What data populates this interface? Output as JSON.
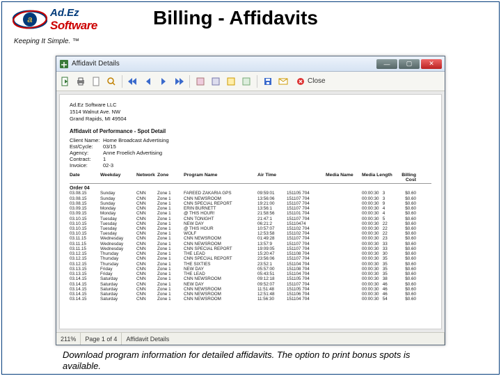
{
  "brand": {
    "line1": "Ad.Ez",
    "line2": "Software",
    "tagline": "Keeping It Simple. ™"
  },
  "slide": {
    "title": "Billing - Affidavits",
    "caption": "Download program information for detailed affidavits. The option to print bonus spots is available."
  },
  "window": {
    "title": "Affidavit Details",
    "close_label": "Close",
    "status_zoom": "211%",
    "status_page": "Page 1 of 4",
    "status_tab": "Affidavit Details"
  },
  "doc": {
    "company": "Ad.Ez Software LLC",
    "addr1": "1514 Walnut Ave. NW",
    "addr2": "Grand Rapids, MI 49504",
    "section": "Affidavit of Performance - Spot Detail",
    "meta": {
      "client_l": "Client Name:",
      "client_v": "Home Broadcast Advertising",
      "bill_l": "Est/Cycle:",
      "bill_v": "03/15",
      "agency_l": "Agency:",
      "agency_v": "Anne Froelich Advertising",
      "contract_l": "Contract:",
      "contract_v": "1",
      "invoice_l": "Invoice:",
      "invoice_v": "02-3"
    },
    "cols": {
      "date": "Date",
      "weekday": "Weekday",
      "network": "Network",
      "zone": "Zone",
      "program": "Program Name",
      "airtime": "Air Time",
      "air": " ",
      "media": "Media Name",
      "len": "Media Length",
      "bill": "Billing Cost"
    },
    "order_label": "Order 04",
    "rows": [
      {
        "date": "03.08.15",
        "wd": "Sunday",
        "net": "CNN",
        "zone": "Zone 1",
        "prog": "FAREED ZAKARIA GPS",
        "time": "09:59:01",
        "air": "151105 704",
        "media": "",
        "len": "00:00:30",
        "line": "3",
        "bill": "$0.60"
      },
      {
        "date": "03.08.15",
        "wd": "Sunday",
        "net": "CNN",
        "zone": "Zone 1",
        "prog": "CNN NEWSROOM",
        "time": "13:56:06",
        "air": "151107 704",
        "media": "",
        "len": "00:00:30",
        "line": "3",
        "bill": "$0.60"
      },
      {
        "date": "03.08.15",
        "wd": "Sunday",
        "net": "CNN",
        "zone": "Zone 1",
        "prog": "CNN SPECIAL REPORT",
        "time": "19:21:00",
        "air": "151107 704",
        "media": "",
        "len": "00:00:30",
        "line": "9",
        "bill": "$0.60"
      },
      {
        "date": "03.09.15",
        "wd": "Monday",
        "net": "CNN",
        "zone": "Zone 1",
        "prog": "ERIN BURNETT",
        "time": "13:56:1",
        "air": "151107 704",
        "media": "",
        "len": "00:00:30",
        "line": "4",
        "bill": "$0.60"
      },
      {
        "date": "03.09.15",
        "wd": "Monday",
        "net": "CNN",
        "zone": "Zone 1",
        "prog": "@ THIS HOUR!",
        "time": "21:58:56",
        "air": "151101 704",
        "media": "",
        "len": "00:00:30",
        "line": "4",
        "bill": "$0.60"
      },
      {
        "date": "03.10.15",
        "wd": "Tuesday",
        "net": "CNN",
        "zone": "Zone 1",
        "prog": "CNN TONIGHT",
        "time": "21:47:1",
        "air": "151107 704",
        "media": "",
        "len": "00:00:30",
        "line": "5",
        "bill": "$0.60"
      },
      {
        "date": "03.10.15",
        "wd": "Tuesday",
        "net": "CNN",
        "zone": "Zone 1",
        "prog": "NEW DAY",
        "time": "06:21:2",
        "air": "15110474",
        "media": "",
        "len": "00:00:30",
        "line": "22",
        "bill": "$0.60"
      },
      {
        "date": "03.10.15",
        "wd": "Tuesday",
        "net": "CNN",
        "zone": "Zone 1",
        "prog": "@ THIS HOUR",
        "time": "10:57:07",
        "air": "151102 704",
        "media": "",
        "len": "00:00:30",
        "line": "22",
        "bill": "$0.60"
      },
      {
        "date": "03.10.15",
        "wd": "Tuesday",
        "net": "CNN",
        "zone": "Zone 1",
        "prog": "WOLF",
        "time": "12:53:58",
        "air": "151102 704",
        "media": "",
        "len": "00:00:30",
        "line": "22",
        "bill": "$0.60"
      },
      {
        "date": "03.11.15",
        "wd": "Wednesday",
        "net": "CNN",
        "zone": "Zone 1",
        "prog": "CNN NEWSROOM",
        "time": "01:49:28",
        "air": "151107 704",
        "media": "",
        "len": "00:00:30",
        "line": "23",
        "bill": "$0.60"
      },
      {
        "date": "03.11.15",
        "wd": "Wednesday",
        "net": "CNN",
        "zone": "Zone 1",
        "prog": "CNN NEWSROOM",
        "time": "13:57:9",
        "air": "151107 704",
        "media": "",
        "len": "00:00:30",
        "line": "33",
        "bill": "$0.60"
      },
      {
        "date": "03.11.15",
        "wd": "Wednesday",
        "net": "CNN",
        "zone": "Zone 1",
        "prog": "CNN SPECIAL REPORT",
        "time": "19:09:05",
        "air": "151107 704",
        "media": "",
        "len": "00:00:30",
        "line": "33",
        "bill": "$0.60"
      },
      {
        "date": "03.12.15",
        "wd": "Thursday",
        "net": "CNN",
        "zone": "Zone 1",
        "prog": "THE LEAD",
        "time": "15:20:47",
        "air": "151108 704",
        "media": "",
        "len": "00:00:30",
        "line": "30",
        "bill": "$0.60"
      },
      {
        "date": "03.12.15",
        "wd": "Thursday",
        "net": "CNN",
        "zone": "Zone 1",
        "prog": "CNN SPECIAL REPORT",
        "time": "23:56:06",
        "air": "151107 704",
        "media": "",
        "len": "00:00:30",
        "line": "35",
        "bill": "$0.60"
      },
      {
        "date": "03.12.15",
        "wd": "Thursday",
        "net": "CNN",
        "zone": "Zone 1",
        "prog": "THE SIXTIES",
        "time": "23:52:1",
        "air": "151104 704",
        "media": "",
        "len": "00:00:30",
        "line": "35",
        "bill": "$0.60"
      },
      {
        "date": "03.13.15",
        "wd": "Friday",
        "net": "CNN",
        "zone": "Zone 1",
        "prog": "NEW DAY",
        "time": "05:57:00",
        "air": "151108 704",
        "media": "",
        "len": "00:00:30",
        "line": "35",
        "bill": "$0.60"
      },
      {
        "date": "03.13.15",
        "wd": "Friday",
        "net": "CNN",
        "zone": "Zone 1",
        "prog": "THE LEAD",
        "time": "05:43:51",
        "air": "151104 704",
        "media": "",
        "len": "00:00:30",
        "line": "35",
        "bill": "$0.60"
      },
      {
        "date": "03.14.15",
        "wd": "Saturday",
        "net": "CNN",
        "zone": "Zone 1",
        "prog": "CNN NEWSROOM",
        "time": "09:12:18",
        "air": "151105 704",
        "media": "",
        "len": "00:00:30",
        "line": "38",
        "bill": "$0.60"
      },
      {
        "date": "03.14.15",
        "wd": "Saturday",
        "net": "CNN",
        "zone": "Zone 1",
        "prog": "NEW DAY",
        "time": "09:52:07",
        "air": "151107 704",
        "media": "",
        "len": "00:00:30",
        "line": "46",
        "bill": "$0.60"
      },
      {
        "date": "03.14.15",
        "wd": "Saturday",
        "net": "CNN",
        "zone": "Zone 1",
        "prog": "CNN NEWSROOM",
        "time": "11:51:48",
        "air": "151105 704",
        "media": "",
        "len": "00:00:30",
        "line": "46",
        "bill": "$0.60"
      },
      {
        "date": "03.14.15",
        "wd": "Saturday",
        "net": "CNN",
        "zone": "Zone 1",
        "prog": "CNN NEWSROOM",
        "time": "12:51:48",
        "air": "151106 704",
        "media": "",
        "len": "00:00:30",
        "line": "46",
        "bill": "$0.60"
      },
      {
        "date": "03.14.15",
        "wd": "Saturday",
        "net": "CNN",
        "zone": "Zone 1",
        "prog": "CNN NEWSROOM",
        "time": "11:56:30",
        "air": "151104 704",
        "media": "",
        "len": "00:00:30",
        "line": "54",
        "bill": "$0.60"
      }
    ]
  }
}
